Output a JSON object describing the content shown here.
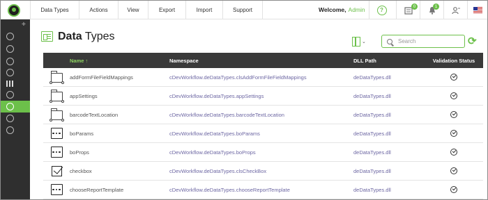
{
  "topbar": {
    "menu": [
      {
        "label": "Data Types",
        "width": 70
      },
      {
        "label": "Actions",
        "width": 56
      },
      {
        "label": "View",
        "width": 43
      },
      {
        "label": "Export",
        "width": 54
      },
      {
        "label": "Import",
        "width": 53
      },
      {
        "label": "Support",
        "width": 58
      }
    ],
    "welcome_label": "Welcome,",
    "user_name": "Admin",
    "help_glyph": "?",
    "badge_tasks": "0",
    "badge_notifications": "1"
  },
  "sidebar": {
    "pin_glyph": "✚",
    "items": [
      {
        "icon": "gear-network-icon"
      },
      {
        "icon": "cloud-icon"
      },
      {
        "icon": "add-icon"
      },
      {
        "icon": "play-icon"
      },
      {
        "icon": "chart-icon"
      },
      {
        "icon": "link-icon"
      },
      {
        "icon": "settings-icon",
        "active": true
      },
      {
        "icon": "search-doc-icon"
      },
      {
        "icon": "help-icon"
      }
    ]
  },
  "page": {
    "title_bold": "Data",
    "title_rest": " Types",
    "search_placeholder": "Search",
    "refresh_glyph": "⟳",
    "chevron_glyph": "⌄"
  },
  "table": {
    "columns": {
      "name": "Name",
      "sort_glyph": "↑",
      "namespace": "Namespace",
      "dll_path": "DLL Path",
      "validation": "Validation Status"
    },
    "rows": [
      {
        "icon": "folder",
        "name": "addFormFileFieldMappings",
        "namespace": "cDevWorkflow.deDataTypes.clsAddFormFileFieldMappings",
        "dll": "deDataTypes.dll",
        "valid": true
      },
      {
        "icon": "folder",
        "name": "appSettings",
        "namespace": "cDevWorkflow.deDataTypes.appSettings",
        "dll": "deDataTypes.dll",
        "valid": true
      },
      {
        "icon": "folder",
        "name": "barcodeTextLocation",
        "namespace": "cDevWorkflow.deDataTypes.barcodeTextLocation",
        "dll": "deDataTypes.dll",
        "valid": true
      },
      {
        "icon": "dots",
        "name": "boParams",
        "namespace": "cDevWorkflow.deDataTypes.boParams",
        "dll": "deDataTypes.dll",
        "valid": true
      },
      {
        "icon": "dots",
        "name": "boProps",
        "namespace": "cDevWorkflow.deDataTypes.boProps",
        "dll": "deDataTypes.dll",
        "valid": true
      },
      {
        "icon": "checkbox",
        "name": "checkbox",
        "namespace": "cDevWorkflow.deDataTypes.clsCheckBox",
        "dll": "deDataTypes.dll",
        "valid": true
      },
      {
        "icon": "dots",
        "name": "chooseReportTemplate",
        "namespace": "cDevWorkflow.deDataTypes.chooseReportTemplate",
        "dll": "deDataTypes.dll",
        "valid": true
      }
    ]
  },
  "colors": {
    "accent": "#6cc04a",
    "header_bg": "#3a3a3a",
    "sidebar_bg": "#2f2f2f",
    "link": "#6d67a3"
  }
}
